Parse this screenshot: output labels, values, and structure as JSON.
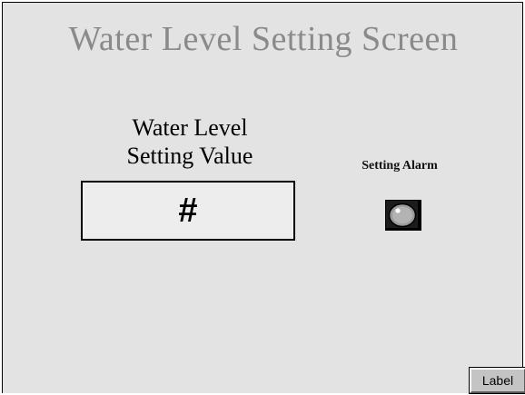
{
  "screen": {
    "title": "Water Level Setting Screen"
  },
  "water_level": {
    "label_line1": "Water Level",
    "label_line2": "Setting Value",
    "value": "#"
  },
  "alarm": {
    "label": "Setting Alarm",
    "icon": "alarm-lamp-icon"
  },
  "footer": {
    "button_label": "Label"
  },
  "colors": {
    "background": "#e3e3e3",
    "title": "#8a8a8a"
  }
}
